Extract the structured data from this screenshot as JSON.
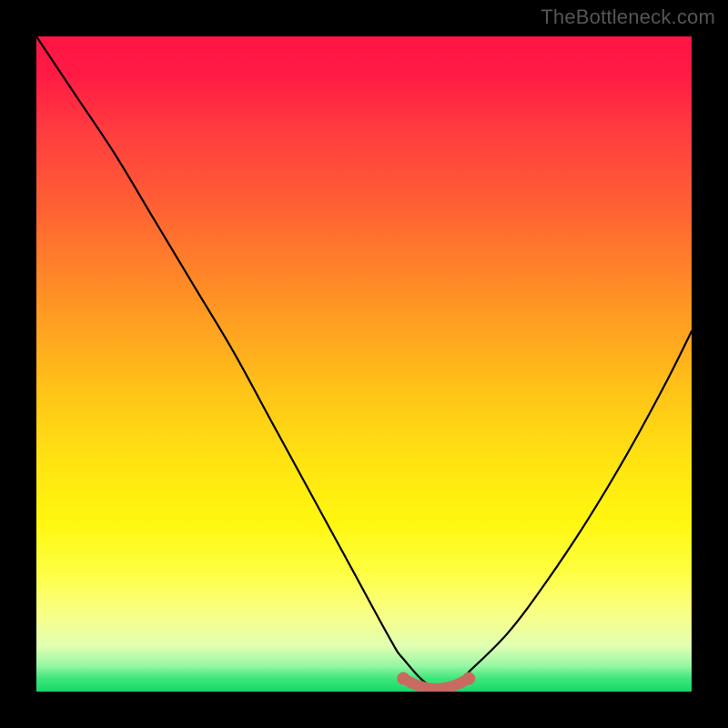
{
  "watermark": "TheBottleneck.com",
  "chart_data": {
    "type": "line",
    "title": "",
    "xlabel": "",
    "ylabel": "",
    "xlim": [
      0,
      100
    ],
    "ylim": [
      0,
      100
    ],
    "grid": false,
    "legend": null,
    "series": [
      {
        "name": "bottleneck-curve",
        "color": "#000000",
        "x": [
          0,
          6,
          12,
          18,
          24,
          30,
          36,
          42,
          48,
          54,
          56,
          60,
          64,
          66,
          72,
          78,
          84,
          90,
          96,
          100
        ],
        "values": [
          100,
          91,
          82,
          72,
          62,
          52,
          41,
          30,
          19,
          8,
          5,
          1,
          1,
          3,
          9,
          17,
          26,
          36,
          47,
          55
        ]
      },
      {
        "name": "highlight-band",
        "color": "#c96a62",
        "x": [
          56,
          58,
          60,
          62,
          64,
          66
        ],
        "values": [
          2,
          1,
          0.5,
          0.5,
          1,
          2
        ]
      }
    ],
    "gradient_stops": [
      {
        "pos": 0.0,
        "color": "#ff1544"
      },
      {
        "pos": 0.06,
        "color": "#ff1b44"
      },
      {
        "pos": 0.14,
        "color": "#ff3b3f"
      },
      {
        "pos": 0.24,
        "color": "#ff5a36"
      },
      {
        "pos": 0.34,
        "color": "#ff7d2b"
      },
      {
        "pos": 0.44,
        "color": "#ffa021"
      },
      {
        "pos": 0.54,
        "color": "#ffc318"
      },
      {
        "pos": 0.64,
        "color": "#ffe112"
      },
      {
        "pos": 0.74,
        "color": "#fff70f"
      },
      {
        "pos": 0.82,
        "color": "#feff44"
      },
      {
        "pos": 0.88,
        "color": "#f9ff85"
      },
      {
        "pos": 0.93,
        "color": "#e2ffb2"
      },
      {
        "pos": 0.96,
        "color": "#98f7a5"
      },
      {
        "pos": 0.98,
        "color": "#3fe67b"
      },
      {
        "pos": 1.0,
        "color": "#17d76a"
      }
    ]
  }
}
